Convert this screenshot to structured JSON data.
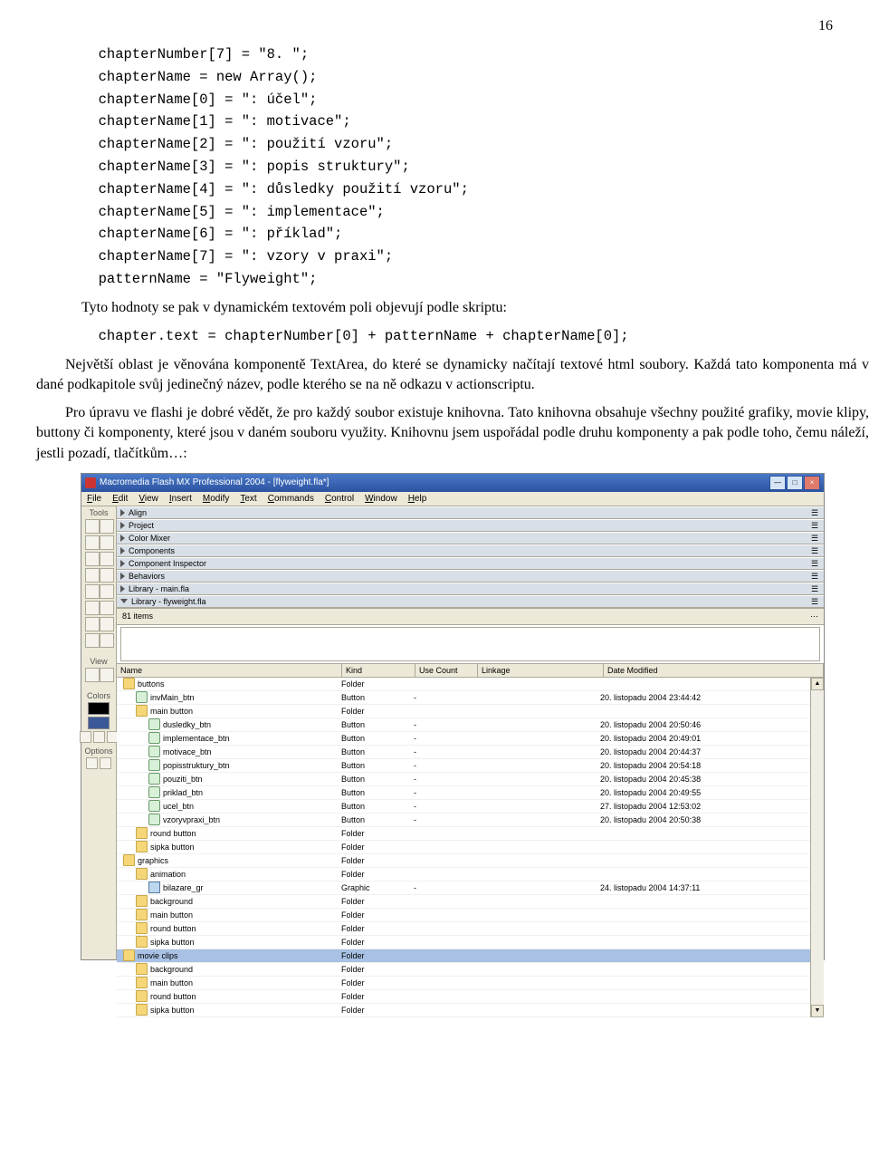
{
  "page_number": "16",
  "code1": "  chapterNumber[7] = \"8. \";\n  chapterName = new Array();\n  chapterName[0] = \": účel\";\n  chapterName[1] = \": motivace\";\n  chapterName[2] = \": použití vzoru\";\n  chapterName[3] = \": popis struktury\";\n  chapterName[4] = \": důsledky použití vzoru\";\n  chapterName[5] = \": implementace\";\n  chapterName[6] = \": příklad\";\n  chapterName[7] = \": vzory v praxi\";\n  patternName = \"Flyweight\";",
  "para1": "Tyto hodnoty se pak v dynamickém textovém poli objevují podle skriptu:",
  "code2": "  chapter.text = chapterNumber[0] + patternName + chapterName[0];",
  "para2a": "Největší oblast je věnována komponentě TextArea, do které se dynamicky načítají textové html soubory. Každá tato komponenta má v dané podkapitole svůj jedinečný název, podle kterého se na ně odkazu v actionscriptu.",
  "para2b": "Pro úpravu ve flashi je dobré vědět, že pro každý soubor existuje knihovna. Tato knihovna obsahuje všechny použité grafiky, movie klipy, buttony či komponenty, které jsou v daném souboru využity. Knihovnu jsem uspořádal podle druhu komponenty a pak podle toho, čemu náleží, jestli pozadí, tlačítkům…:",
  "flash": {
    "title": "Macromedia Flash MX Professional 2004 - [flyweight.fla*]",
    "menu": [
      "File",
      "Edit",
      "View",
      "Insert",
      "Modify",
      "Text",
      "Commands",
      "Control",
      "Window",
      "Help"
    ],
    "tool_groups": {
      "tools": "Tools",
      "view": "View",
      "colors": "Colors",
      "options": "Options"
    },
    "panels": [
      "Align",
      "Project",
      "Color Mixer",
      "Components",
      "Component Inspector",
      "Behaviors",
      "Library - main.fla",
      "Library - flyweight.fla"
    ],
    "lib_count": "81 items",
    "columns": [
      "Name",
      "Kind",
      "Use Count",
      "Linkage",
      "Date Modified"
    ],
    "rows": [
      {
        "indent": 0,
        "icon": "folder",
        "name": "buttons",
        "kind": "Folder",
        "use": "",
        "date": ""
      },
      {
        "indent": 1,
        "icon": "button",
        "name": "invMain_btn",
        "kind": "Button",
        "use": "-",
        "date": "20. listopadu 2004 23:44:42"
      },
      {
        "indent": 1,
        "icon": "folder",
        "name": "main button",
        "kind": "Folder",
        "use": "",
        "date": ""
      },
      {
        "indent": 2,
        "icon": "button",
        "name": "dusledky_btn",
        "kind": "Button",
        "use": "-",
        "date": "20. listopadu 2004 20:50:46"
      },
      {
        "indent": 2,
        "icon": "button",
        "name": "implementace_btn",
        "kind": "Button",
        "use": "-",
        "date": "20. listopadu 2004 20:49:01"
      },
      {
        "indent": 2,
        "icon": "button",
        "name": "motivace_btn",
        "kind": "Button",
        "use": "-",
        "date": "20. listopadu 2004 20:44:37"
      },
      {
        "indent": 2,
        "icon": "button",
        "name": "popisstruktury_btn",
        "kind": "Button",
        "use": "-",
        "date": "20. listopadu 2004 20:54:18"
      },
      {
        "indent": 2,
        "icon": "button",
        "name": "pouziti_btn",
        "kind": "Button",
        "use": "-",
        "date": "20. listopadu 2004 20:45:38"
      },
      {
        "indent": 2,
        "icon": "button",
        "name": "priklad_btn",
        "kind": "Button",
        "use": "-",
        "date": "20. listopadu 2004 20:49:55"
      },
      {
        "indent": 2,
        "icon": "button",
        "name": "ucel_btn",
        "kind": "Button",
        "use": "-",
        "date": "27. listopadu 2004 12:53:02"
      },
      {
        "indent": 2,
        "icon": "button",
        "name": "vzoryvpraxi_btn",
        "kind": "Button",
        "use": "-",
        "date": "20. listopadu 2004 20:50:38"
      },
      {
        "indent": 1,
        "icon": "folder",
        "name": "round button",
        "kind": "Folder",
        "use": "",
        "date": ""
      },
      {
        "indent": 1,
        "icon": "folder",
        "name": "sipka button",
        "kind": "Folder",
        "use": "",
        "date": ""
      },
      {
        "indent": 0,
        "icon": "folder",
        "name": "graphics",
        "kind": "Folder",
        "use": "",
        "date": ""
      },
      {
        "indent": 1,
        "icon": "folder",
        "name": "animation",
        "kind": "Folder",
        "use": "",
        "date": ""
      },
      {
        "indent": 2,
        "icon": "graphic",
        "name": "bilazare_gr",
        "kind": "Graphic",
        "use": "-",
        "date": "24. listopadu 2004 14:37:11"
      },
      {
        "indent": 1,
        "icon": "folder",
        "name": "background",
        "kind": "Folder",
        "use": "",
        "date": ""
      },
      {
        "indent": 1,
        "icon": "folder",
        "name": "main button",
        "kind": "Folder",
        "use": "",
        "date": ""
      },
      {
        "indent": 1,
        "icon": "folder",
        "name": "round button",
        "kind": "Folder",
        "use": "",
        "date": ""
      },
      {
        "indent": 1,
        "icon": "folder",
        "name": "sipka button",
        "kind": "Folder",
        "use": "",
        "date": ""
      },
      {
        "indent": 0,
        "icon": "folder",
        "name": "movie clips",
        "kind": "Folder",
        "use": "",
        "date": "",
        "selected": true
      },
      {
        "indent": 1,
        "icon": "folder",
        "name": "background",
        "kind": "Folder",
        "use": "",
        "date": ""
      },
      {
        "indent": 1,
        "icon": "folder",
        "name": "main button",
        "kind": "Folder",
        "use": "",
        "date": ""
      },
      {
        "indent": 1,
        "icon": "folder",
        "name": "round button",
        "kind": "Folder",
        "use": "",
        "date": ""
      },
      {
        "indent": 1,
        "icon": "folder",
        "name": "sipka button",
        "kind": "Folder",
        "use": "",
        "date": ""
      }
    ]
  }
}
